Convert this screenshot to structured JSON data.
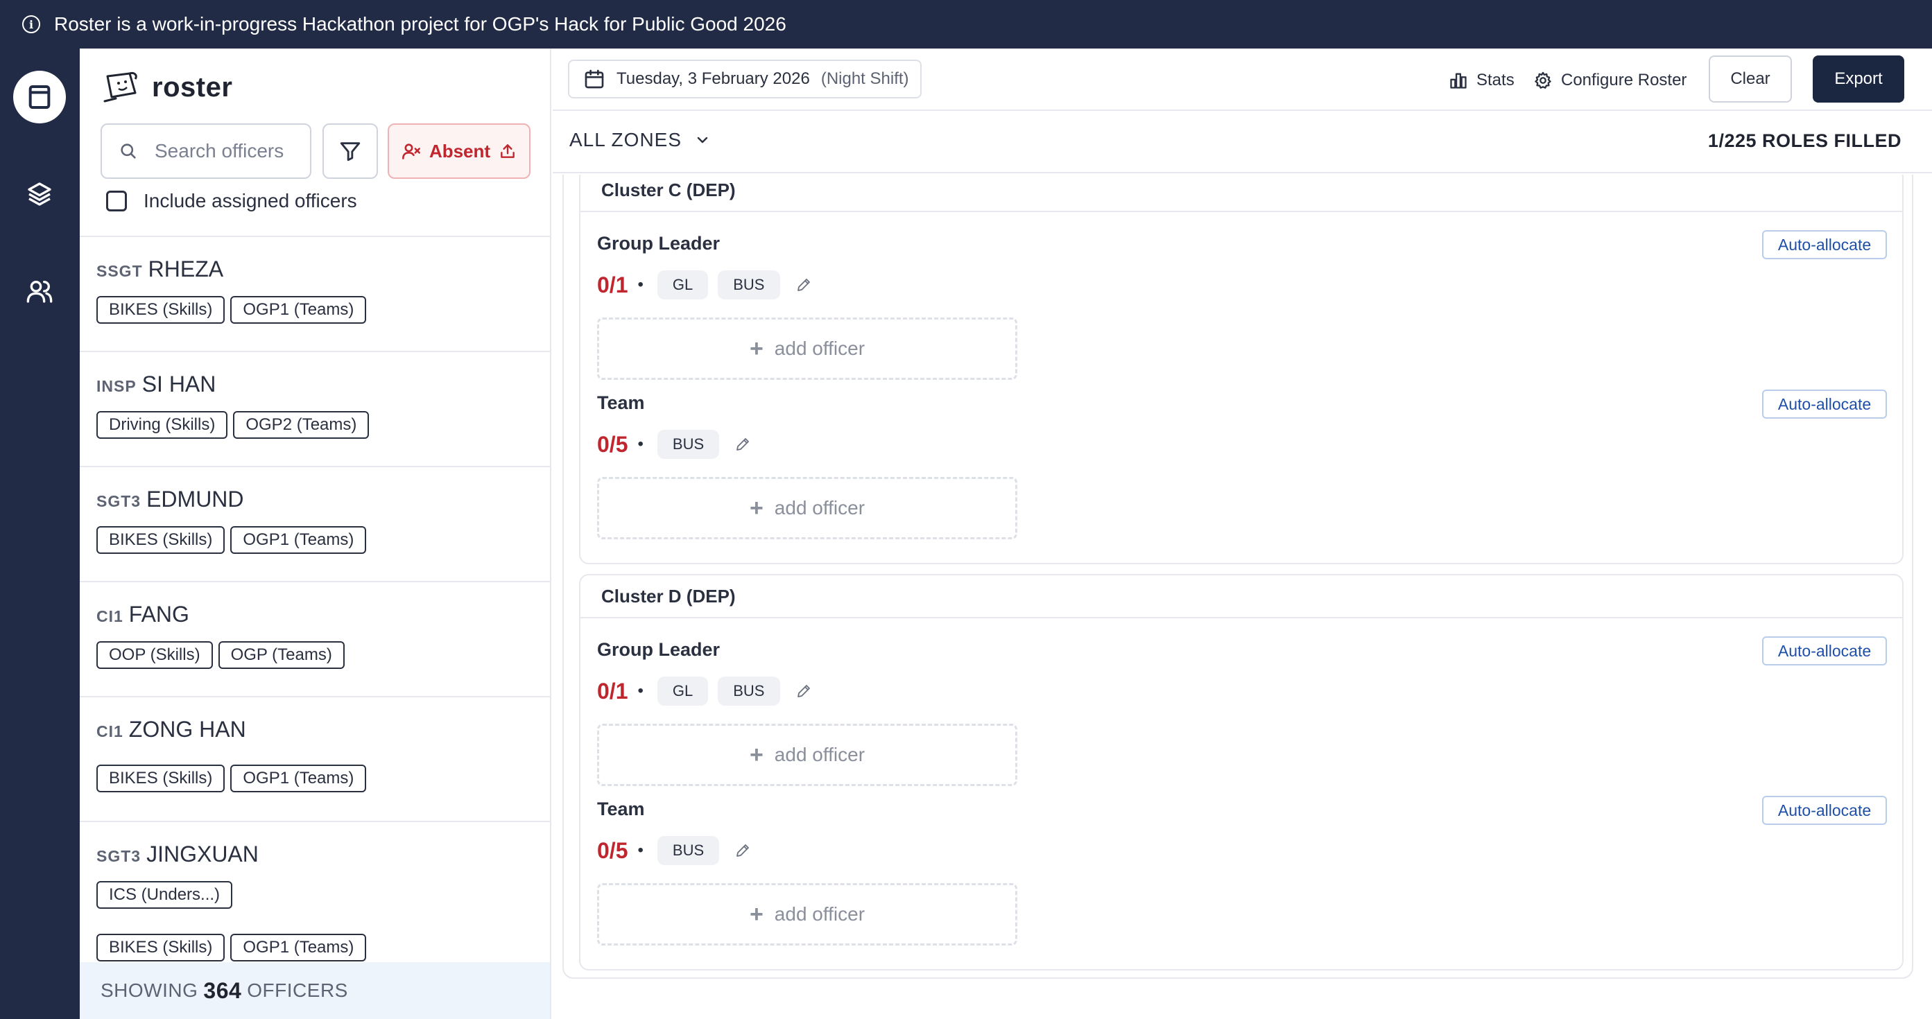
{
  "banner": {
    "text": "Roster is a work-in-progress Hackathon project for OGP's Hack for Public Good 2026"
  },
  "app": {
    "name": "roster"
  },
  "search": {
    "placeholder": "Search officers"
  },
  "absent_label": "Absent",
  "include_assigned_label": "Include assigned officers",
  "officers": [
    {
      "rank": "SSGT",
      "name": "RHEZA",
      "tags": [
        "BIKES (Skills)",
        "OGP1 (Teams)"
      ]
    },
    {
      "rank": "INSP",
      "name": "SI HAN",
      "tags": [
        "Driving (Skills)",
        "OGP2 (Teams)"
      ]
    },
    {
      "rank": "SGT3",
      "name": "EDMUND",
      "tags": [
        "BIKES (Skills)",
        "OGP1 (Teams)"
      ]
    },
    {
      "rank": "CI1",
      "name": "FANG",
      "tags": [
        "OOP (Skills)",
        "OGP (Teams)"
      ]
    },
    {
      "rank": "CI1",
      "name": "ZONG HAN",
      "tags": [
        "BIKES (Skills)",
        "OGP1 (Teams)"
      ]
    },
    {
      "rank": "SGT3",
      "name": "JINGXUAN",
      "tags": [
        "ICS (Unders...)",
        "BIKES (Skills)",
        "OGP1 (Teams)"
      ]
    }
  ],
  "showing": {
    "prefix": "SHOWING",
    "count": "364",
    "suffix": "OFFICERS"
  },
  "topbar": {
    "date": "Tuesday, 3 February 2026",
    "shift": "(Night Shift)",
    "stats_label": "Stats",
    "configure_label": "Configure Roster",
    "clear_label": "Clear",
    "export_label": "Export"
  },
  "zone": {
    "label": "ALL ZONES",
    "roles_filled": "1/225 ROLES FILLED"
  },
  "clusters": [
    {
      "name": "Cluster C (DEP)",
      "roles": [
        {
          "title": "Group Leader",
          "count": "0/1",
          "pills": [
            "GL",
            "BUS"
          ],
          "auto_label": "Auto-allocate",
          "add_label": "add officer"
        },
        {
          "title": "Team",
          "count": "0/5",
          "pills": [
            "BUS"
          ],
          "auto_label": "Auto-allocate",
          "add_label": "add officer"
        }
      ]
    },
    {
      "name": "Cluster D (DEP)",
      "roles": [
        {
          "title": "Group Leader",
          "count": "0/1",
          "pills": [
            "GL",
            "BUS"
          ],
          "auto_label": "Auto-allocate",
          "add_label": "add officer"
        },
        {
          "title": "Team",
          "count": "0/5",
          "pills": [
            "BUS"
          ],
          "auto_label": "Auto-allocate",
          "add_label": "add officer"
        }
      ]
    }
  ],
  "colors": {
    "navy": "#222b45",
    "danger": "#c0262d",
    "link": "#1e4fa8"
  }
}
